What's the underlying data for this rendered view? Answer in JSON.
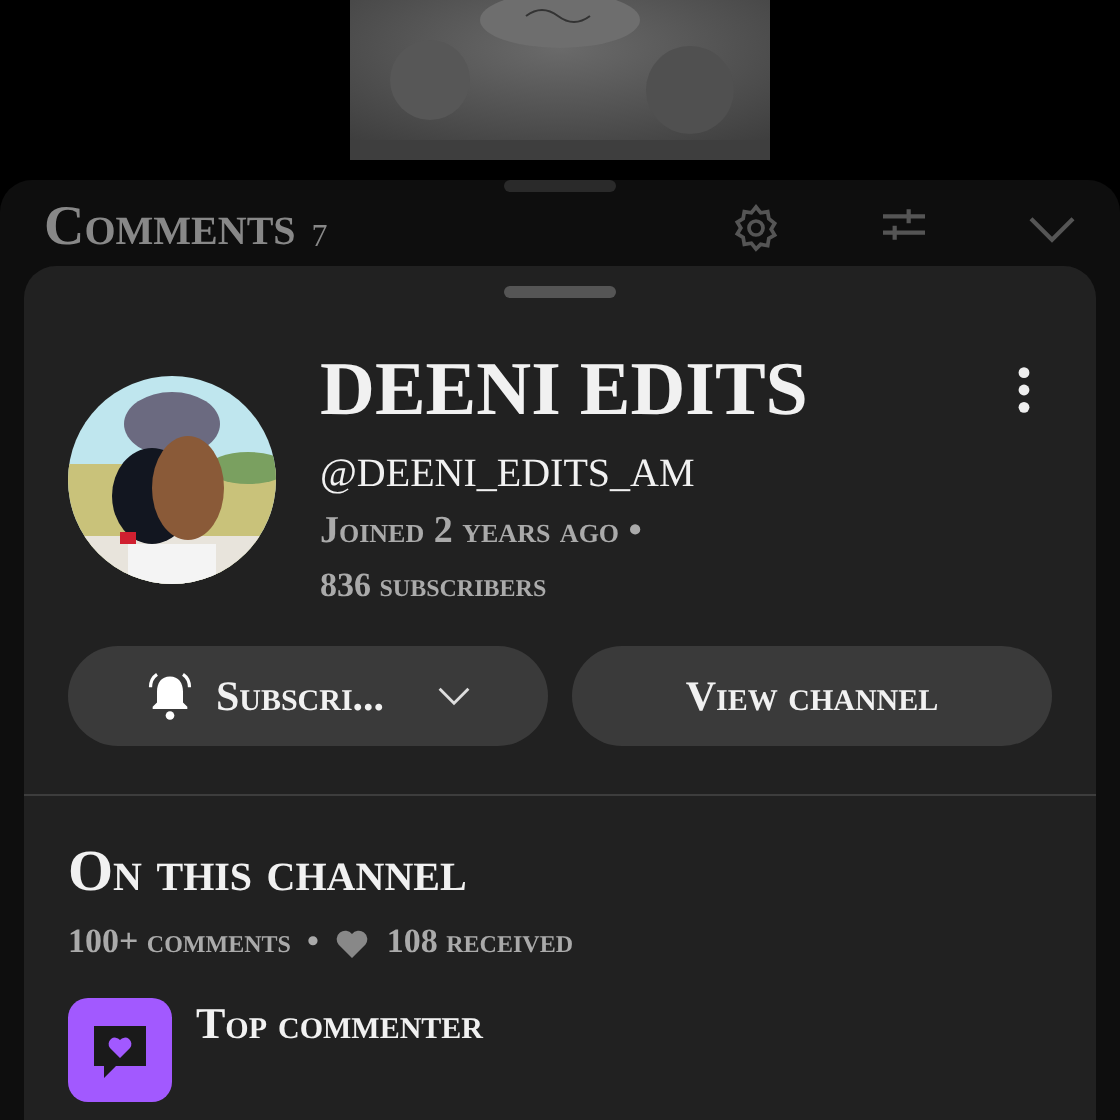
{
  "comments_panel": {
    "title": "Comments",
    "count": "7"
  },
  "channel": {
    "name": "DEENI EDITS",
    "handle": "@DEENI_EDITS_AM",
    "joined": "Joined 2 years ago •",
    "subscribers": "836 subscribers"
  },
  "buttons": {
    "subscribe": "Subscri...",
    "view": "View channel"
  },
  "on_channel": {
    "title": "On this channel",
    "comments": "100+ comments",
    "separator": "•",
    "likes": "108 received",
    "badges": [
      {
        "label": "Top commenter"
      }
    ]
  }
}
